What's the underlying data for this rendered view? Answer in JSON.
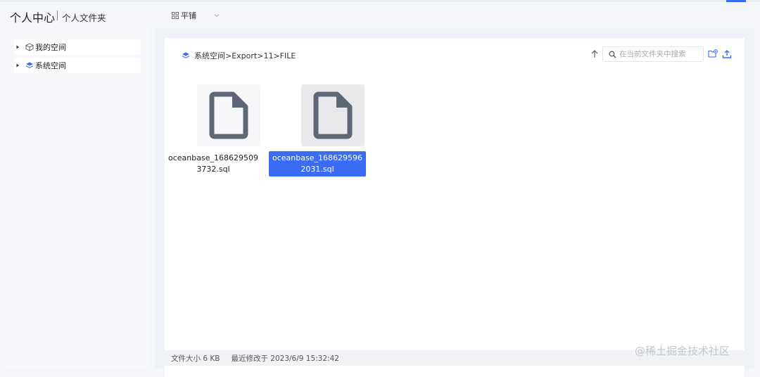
{
  "header": {
    "title": "个人中心",
    "subtitle": "个人文件夹",
    "view_mode": "平铺"
  },
  "sidebar": {
    "items": [
      {
        "label": "我的空间",
        "icon": "cube-icon"
      },
      {
        "label": "系统空间",
        "icon": "layers-icon"
      }
    ]
  },
  "toolbar": {
    "breadcrumb": "系统空间>Export>11>FILE",
    "search_placeholder": "在当前文件夹中搜索"
  },
  "files": [
    {
      "name": "oceanbase_1686295093732.sql",
      "selected": false
    },
    {
      "name": "oceanbase_1686295962031.sql",
      "selected": true
    }
  ],
  "status": {
    "size": "文件大小 6 KB",
    "modified": "最近修改于 2023/6/9 15:32:42"
  },
  "watermark": "@稀土掘金技术社区",
  "colors": {
    "accent": "#3b6cf6",
    "icon_gray": "#5f6675"
  }
}
